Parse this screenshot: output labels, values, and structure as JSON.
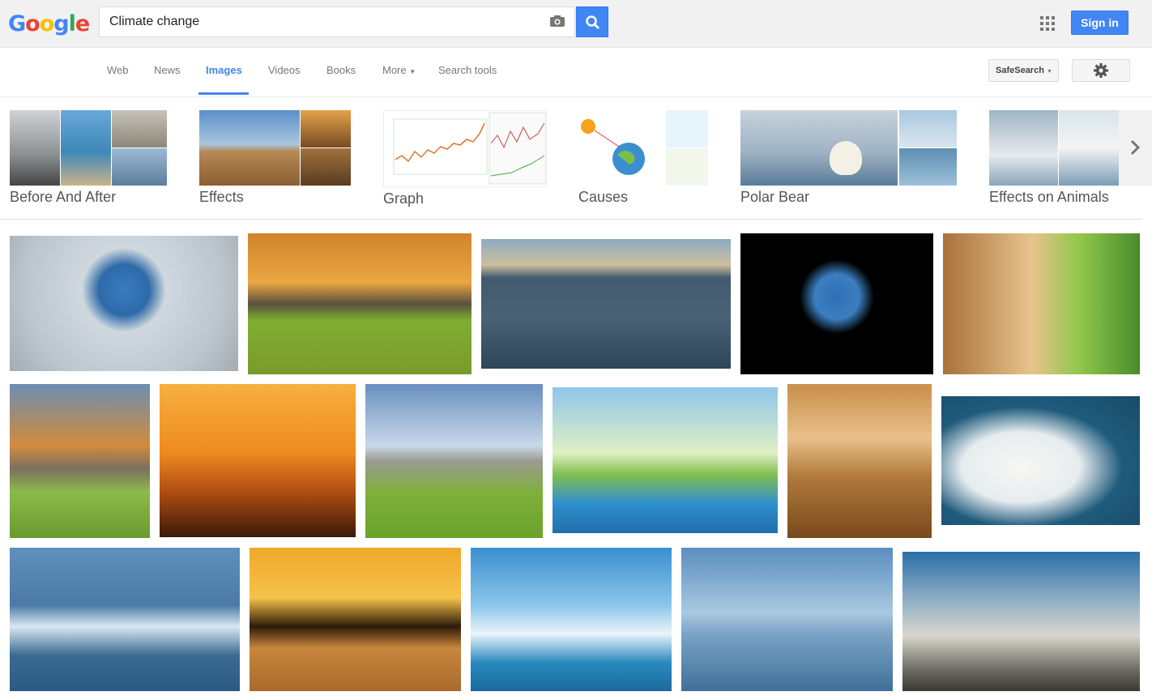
{
  "logo_letters": [
    "G",
    "o",
    "o",
    "g",
    "l",
    "e"
  ],
  "search": {
    "query": "Climate change"
  },
  "header": {
    "signin_label": "Sign in"
  },
  "nav": {
    "tabs": [
      {
        "label": "Web"
      },
      {
        "label": "News"
      },
      {
        "label": "Images"
      },
      {
        "label": "Videos"
      },
      {
        "label": "Books"
      },
      {
        "label": "More"
      },
      {
        "label": "Search tools"
      }
    ],
    "safesearch_label": "SafeSearch"
  },
  "related": [
    {
      "label": "Before And After"
    },
    {
      "label": "Effects"
    },
    {
      "label": "Graph"
    },
    {
      "label": "Causes"
    },
    {
      "label": "Polar Bear"
    },
    {
      "label": "Effects on Animals"
    }
  ],
  "colors": {
    "accent": "#4285f4",
    "tab_inactive": "#777777"
  }
}
